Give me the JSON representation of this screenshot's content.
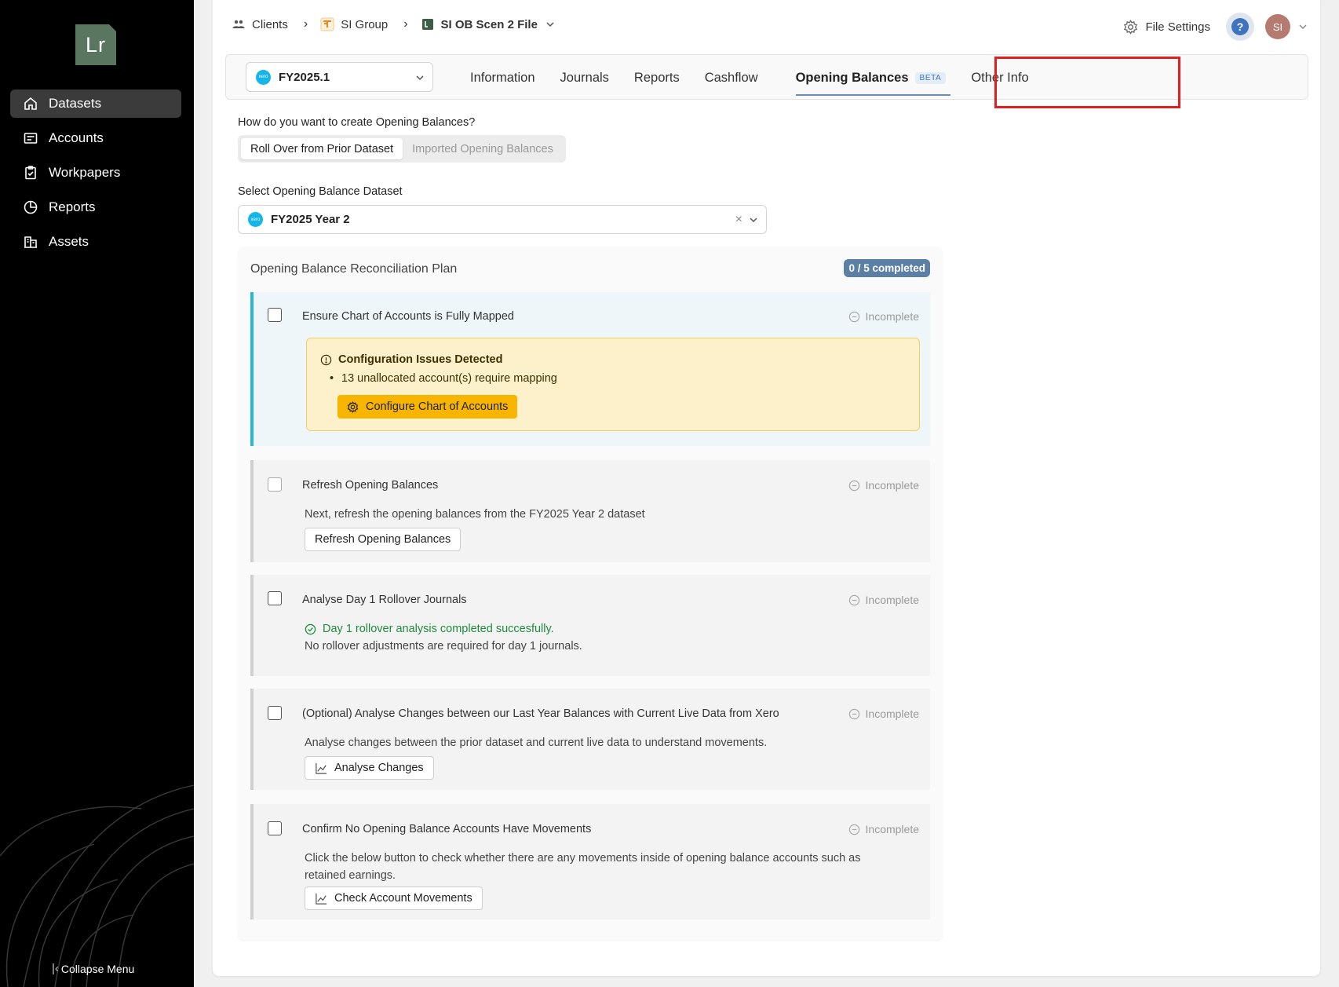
{
  "sidebar": {
    "logo": "Lr",
    "items": [
      {
        "label": "Datasets",
        "icon": "home-icon"
      },
      {
        "label": "Accounts",
        "icon": "list-icon"
      },
      {
        "label": "Workpapers",
        "icon": "clipboard-icon"
      },
      {
        "label": "Reports",
        "icon": "pie-chart-icon"
      },
      {
        "label": "Assets",
        "icon": "building-icon"
      }
    ],
    "collapse_label": "Collapse Menu"
  },
  "breadcrumb": {
    "clients": "Clients",
    "group": "SI Group",
    "file": "SI OB Scen 2 File"
  },
  "header": {
    "file_settings": "File Settings",
    "help": "?",
    "avatar": "SI"
  },
  "dataset": {
    "logo_text": "xero",
    "value": "FY2025.1"
  },
  "tabs": {
    "information": "Information",
    "journals": "Journals",
    "reports": "Reports",
    "cashflow": "Cashflow",
    "opening_balances": "Opening Balances",
    "beta": "BETA",
    "other_info": "Other Info"
  },
  "create_question": "How do you want to create Opening Balances?",
  "mode": {
    "rollover": "Roll Over from Prior Dataset",
    "imported": "Imported Opening Balances"
  },
  "select_label": "Select Opening Balance Dataset",
  "ob_dataset": {
    "value": "FY2025 Year 2",
    "clear": "×"
  },
  "plan": {
    "title": "Opening Balance Reconciliation Plan",
    "badge": "0 / 5 completed",
    "steps": [
      {
        "title": "Ensure Chart of Accounts is Fully Mapped",
        "status": "Incomplete",
        "alert_title": "Configuration Issues Detected",
        "alert_item": "13 unallocated account(s) require mapping",
        "button": "Configure Chart of Accounts"
      },
      {
        "title": "Refresh Opening Balances",
        "status": "Incomplete",
        "desc": "Next, refresh the opening balances from the FY2025 Year 2 dataset",
        "button": "Refresh Opening Balances"
      },
      {
        "title": "Analyse Day 1 Rollover Journals",
        "status": "Incomplete",
        "success": "Day 1 rollover analysis completed succesfully.",
        "desc": "No rollover adjustments are required for day 1 journals."
      },
      {
        "title": "(Optional) Analyse Changes between our Last Year Balances with Current Live Data from Xero",
        "status": "Incomplete",
        "desc": "Analyse changes between the prior dataset and current live data to understand movements.",
        "button": "Analyse Changes"
      },
      {
        "title": "Confirm No Opening Balance Accounts Have Movements",
        "status": "Incomplete",
        "desc": "Click the below button to check whether there are any movements inside of opening balance accounts such as retained earnings.",
        "button": "Check Account Movements"
      }
    ]
  },
  "colors": {
    "sidebar_bg": "#000000",
    "accent_cyan": "#2ab7d6",
    "badge_blue": "#5b7fa5",
    "warning_bg": "#fcf1cb",
    "warning_button": "#f7b500",
    "success_green": "#1e8c3d",
    "highlight_red": "#e01f1f"
  }
}
